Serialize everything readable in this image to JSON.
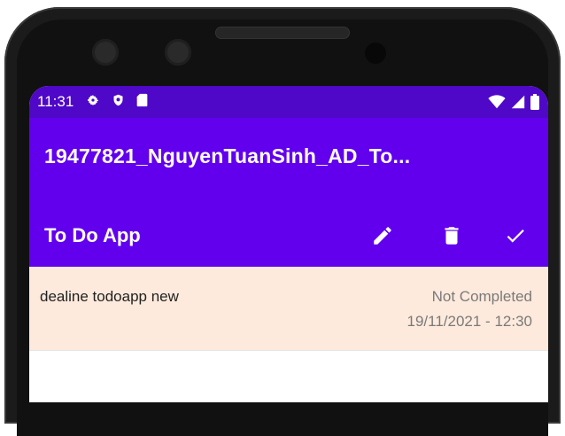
{
  "status_bar": {
    "time": "11:31",
    "icons": [
      "gear-icon",
      "shield-icon",
      "sd-card-icon"
    ],
    "right_icons": [
      "wifi-icon",
      "signal-icon",
      "battery-icon"
    ]
  },
  "app_bar": {
    "title": "19477821_NguyenTuanSinh_AD_To..."
  },
  "toolbar": {
    "title": "To Do App",
    "actions": [
      "edit-icon",
      "delete-icon",
      "check-icon"
    ]
  },
  "todos": [
    {
      "title": "dealine todoapp new",
      "status": "Not Completed",
      "date": "19/11/2021 - 12:30"
    }
  ],
  "colors": {
    "primary": "#6200ee",
    "primary_dark": "#4f07c8",
    "item_background": "#fdeadc"
  }
}
